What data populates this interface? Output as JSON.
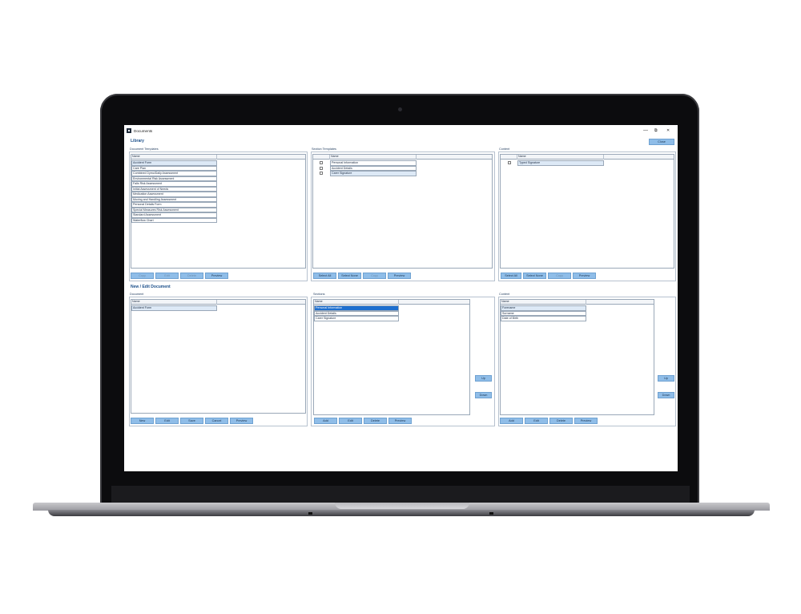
{
  "window": {
    "title": "Documents",
    "minimize": "—",
    "maximize": "⧉",
    "close": "✕"
  },
  "library": {
    "title": "Library",
    "close_button": "Close",
    "document_templates": {
      "label": "Document Templates",
      "column": "Name",
      "rows": [
        "Accident Form",
        "Care Plan",
        "Combined Dymo/Daily Assessment",
        "Environmental Risk Assessment",
        "Falls Risk Assessment",
        "Initial Assessment of Needs",
        "Medication Assessment",
        "Moving and Handling Assessment",
        "Personal Details Form",
        "Special Measures Risk Assessment",
        "Standard Assessment",
        "Waterflow Chart"
      ],
      "buttons": [
        "Copy",
        "Edit",
        "Delete",
        "Preview"
      ]
    },
    "section_templates": {
      "label": "Section Templates",
      "column": "Name",
      "rows": [
        "Personal Information",
        "Accident Details",
        "Carer Signature"
      ],
      "buttons": [
        "Select All",
        "Select None",
        "Copy",
        "Preview"
      ]
    },
    "content": {
      "label": "Content",
      "column": "Name",
      "rows": [
        "Typed Signature"
      ],
      "buttons": [
        "Select All",
        "Select None",
        "Copy",
        "Preview"
      ]
    }
  },
  "new_edit": {
    "title": "New / Edit Document",
    "document": {
      "label": "Document",
      "column": "Name",
      "rows": [
        "Accident Form"
      ],
      "buttons": [
        "New",
        "Edit",
        "Save",
        "Cancel",
        "Preview"
      ]
    },
    "sections": {
      "label": "Sections",
      "column": "Name",
      "rows": [
        "Personal Information",
        "Accident Details",
        "Carer Signature"
      ],
      "buttons": [
        "Add",
        "Edit",
        "Delete",
        "Preview"
      ],
      "up": "Up",
      "down": "Down"
    },
    "content": {
      "label": "Content",
      "column": "Name",
      "rows": [
        "Forename",
        "Surname",
        "Date of Birth"
      ],
      "buttons": [
        "Add",
        "Edit",
        "Delete",
        "Preview"
      ],
      "up": "Up",
      "down": "Down"
    }
  }
}
